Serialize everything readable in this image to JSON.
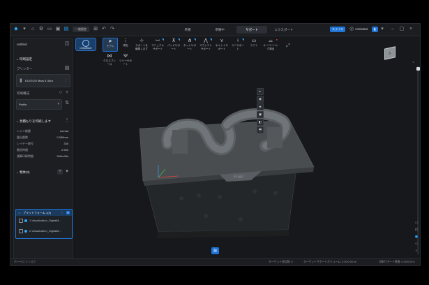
{
  "topbar": {
    "printer_select": "一般設定",
    "tabs": [
      "準備",
      "準備中",
      "サポート",
      "エクスポート"
    ],
    "active_tab_index": 2,
    "pro_label": "スライス",
    "assistant_label": "Assistant"
  },
  "left_panel": {
    "project_name": "untitled",
    "print_settings_title": "印刷設定",
    "printer_label": "プリンター",
    "printer_name": "ELEGOO Mars 5 Ultra",
    "profile_label": "印刷構成",
    "profile_value": "Profile",
    "print_params_title": "見積もりを印刷します",
    "params": [
      {
        "key": "レジン総重",
        "value": "normal"
      },
      {
        "key": "露出層数",
        "value": "0.050mm"
      },
      {
        "key": "レイヤー層号",
        "value": "335"
      },
      {
        "key": "最低時間",
        "value": "2.500"
      },
      {
        "key": "通算印刷時間",
        "value": "5h5m45s"
      }
    ],
    "objects_title": "物体(3)",
    "platform_label": "プラットフォーム 1(3)",
    "objects": [
      "1.Visualization_DigitalM...",
      "2.Visualization_DigitalM..."
    ]
  },
  "toolbar": {
    "chitubox_label": "ChituSlicer",
    "tools": [
      {
        "label": "モデル",
        "icon": "cursor-icon"
      },
      {
        "label": "測定",
        "icon": "ruler-icon"
      },
      {
        "label": "サポートを編集します",
        "icon": "support-edit-icon"
      },
      {
        "label": "マニュアルサポート",
        "icon": "manual-support-icon"
      },
      {
        "label": "パッドサポート",
        "icon": "pad-support-icon"
      },
      {
        "label": "ネットサポート",
        "icon": "net-support-icon"
      },
      {
        "label": "マウンテンサポート",
        "icon": "mountain-support-icon"
      },
      {
        "label": "ポイントサポート",
        "icon": "point-support-icon"
      },
      {
        "label": "ミニサポート",
        "icon": "mini-support-icon"
      },
      {
        "label": "ラフト",
        "icon": "raft-icon"
      },
      {
        "label": "オーバーハング検出",
        "icon": "overhang-icon"
      },
      {
        "label": "クロスブレース",
        "icon": "crossbrace-icon"
      },
      {
        "label": "ツリーサポート",
        "icon": "tree-support-icon"
      }
    ]
  },
  "viewport": {
    "plate_label": "Front",
    "cube_label": "上"
  },
  "status": {
    "left": "ボードロ ソンスク",
    "model_points": "ターゲット頂点数: 0",
    "target_volume": "ターゲットサポートボリューム: 0.00/0.00 ml",
    "support_time": "印刷サポート時間: 0.00/0.00 h"
  },
  "colors": {
    "accent": "#1f74d6",
    "background": "#16181b",
    "panel": "#1c1e22"
  }
}
